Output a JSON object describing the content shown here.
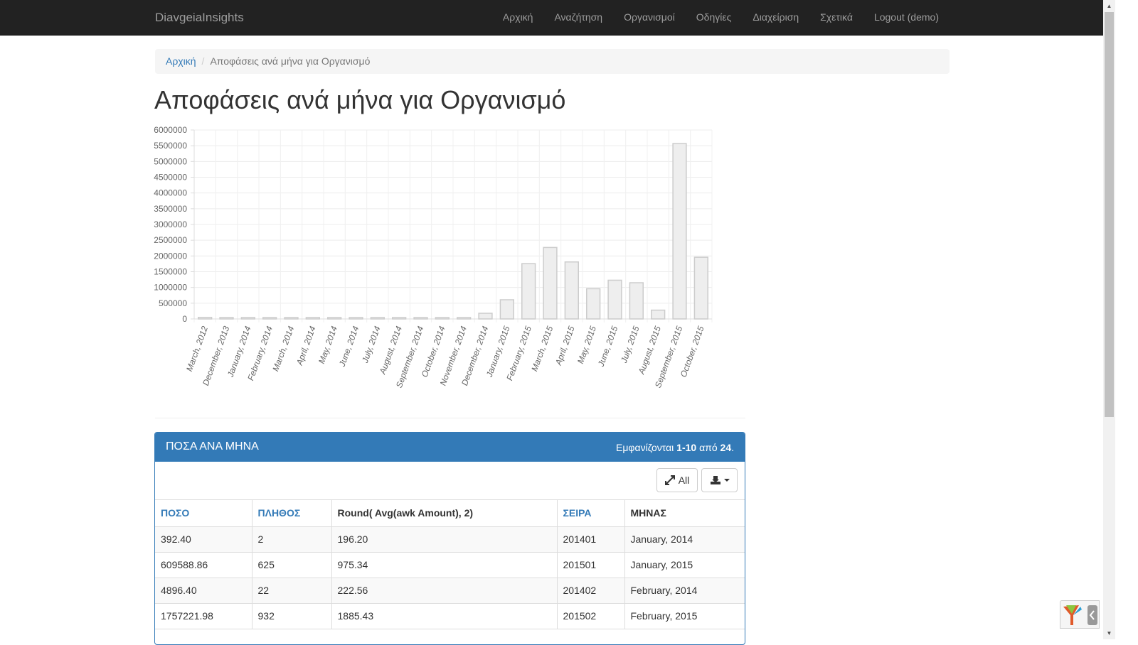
{
  "navbar": {
    "brand": "DiavgeiaInsights",
    "items": [
      "Αρχική",
      "Αναζήτηση",
      "Οργανισμοί",
      "Οδηγίες",
      "Διαχείριση",
      "Σχετικά",
      "Logout (demo)"
    ]
  },
  "breadcrumb": {
    "home": "Αρχική",
    "separator": "/",
    "current": "Αποφάσεις ανά μήνα για Οργανισμό"
  },
  "page_title": "Αποφάσεις ανά μήνα για Οργανισμό",
  "chart_data": {
    "type": "bar",
    "categories": [
      "March, 2012",
      "December, 2013",
      "January, 2014",
      "February, 2014",
      "March, 2014",
      "April, 2014",
      "May, 2014",
      "June, 2014",
      "July, 2014",
      "August, 2014",
      "September, 2014",
      "October, 2014",
      "November, 2014",
      "December, 2014",
      "January, 2015",
      "February, 2015",
      "March, 2015",
      "April, 2015",
      "May, 2015",
      "June, 2015",
      "July, 2015",
      "August, 2015",
      "September, 2015",
      "October, 2015"
    ],
    "values": [
      50000,
      400,
      392.4,
      4896.4,
      15000,
      20000,
      8000,
      20000,
      12000,
      5000,
      20000,
      15000,
      30000,
      180000,
      609588.86,
      1757221.98,
      2270000,
      1810000,
      960000,
      1230000,
      1150000,
      280000,
      5570000,
      1960000
    ],
    "ytick_labels": [
      "6000000",
      "5500000",
      "5000000",
      "4500000",
      "4000000",
      "3500000",
      "3000000",
      "2500000",
      "2000000",
      "1500000",
      "1000000",
      "500000",
      "0"
    ],
    "ylim": [
      0,
      6000000
    ],
    "grid": true,
    "bar_color": "#eeeeee",
    "bar_border": "#cccccc"
  },
  "panel": {
    "title": "ΠΟΣΑ ΑΝΑ ΜΗΝΑ",
    "summary_prefix": "Εμφανίζονται",
    "summary_range": "1-10",
    "summary_mid": "από",
    "summary_total": "24",
    "summary_suffix": ".",
    "btn_all": "All",
    "export_icon": "export-icon"
  },
  "table": {
    "headers": [
      "ΠΟΣΟ",
      "ΠΛΗΘΟΣ",
      "Round( Avg(awk Amount), 2)",
      "ΣΕΙΡΑ",
      "ΜΗΝΑΣ"
    ],
    "rows": [
      [
        "392.40",
        "2",
        "196.20",
        "201401",
        "January, 2014"
      ],
      [
        "609588.86",
        "625",
        "975.34",
        "201501",
        "January, 2015"
      ],
      [
        "4896.40",
        "22",
        "222.56",
        "201402",
        "February, 2014"
      ],
      [
        "1757221.98",
        "932",
        "1885.43",
        "201502",
        "February, 2015"
      ]
    ]
  },
  "colors": {
    "navbar": "#222222",
    "link": "#337ab7",
    "panel_primary": "#337ab7"
  }
}
